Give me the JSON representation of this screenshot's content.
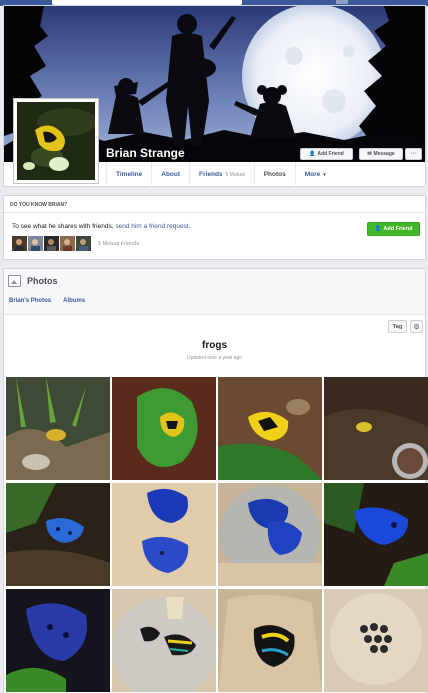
{
  "colors": {
    "facebook_blue": "#3b5998",
    "add_friend_green": "#42b72a",
    "page_bg": "#e9ebee"
  },
  "profile": {
    "name": "Brian Strange"
  },
  "cover_buttons": {
    "add_friend": "Add Friend",
    "message": "Message",
    "more": "···"
  },
  "tabs": [
    {
      "label": "Timeline"
    },
    {
      "label": "About"
    },
    {
      "label": "Friends",
      "sub": "5 Mutual"
    },
    {
      "label": "Photos"
    },
    {
      "label": "More",
      "arrow": "▾"
    }
  ],
  "know": {
    "heading": "DO YOU KNOW BRIAN?",
    "text_prefix": "To see what he shares with friends, ",
    "link": "send him a friend request.",
    "mutual_label": "5 Mutual Friends",
    "add_friend_label": "Add Friend"
  },
  "photos": {
    "title": "Photos",
    "links": [
      "Brian's Photos",
      "Albums"
    ],
    "tag_label": "Tag",
    "gear_icon": "⚙",
    "album_title": "frogs",
    "album_updated": "Updated over a year ago",
    "grid": [
      "frog-photo-1",
      "frog-photo-2",
      "frog-photo-3",
      "frog-photo-4",
      "frog-photo-5",
      "frog-photo-6",
      "frog-photo-7",
      "frog-photo-8",
      "frog-photo-9",
      "frog-photo-10",
      "frog-photo-11",
      "frog-photo-12"
    ]
  }
}
